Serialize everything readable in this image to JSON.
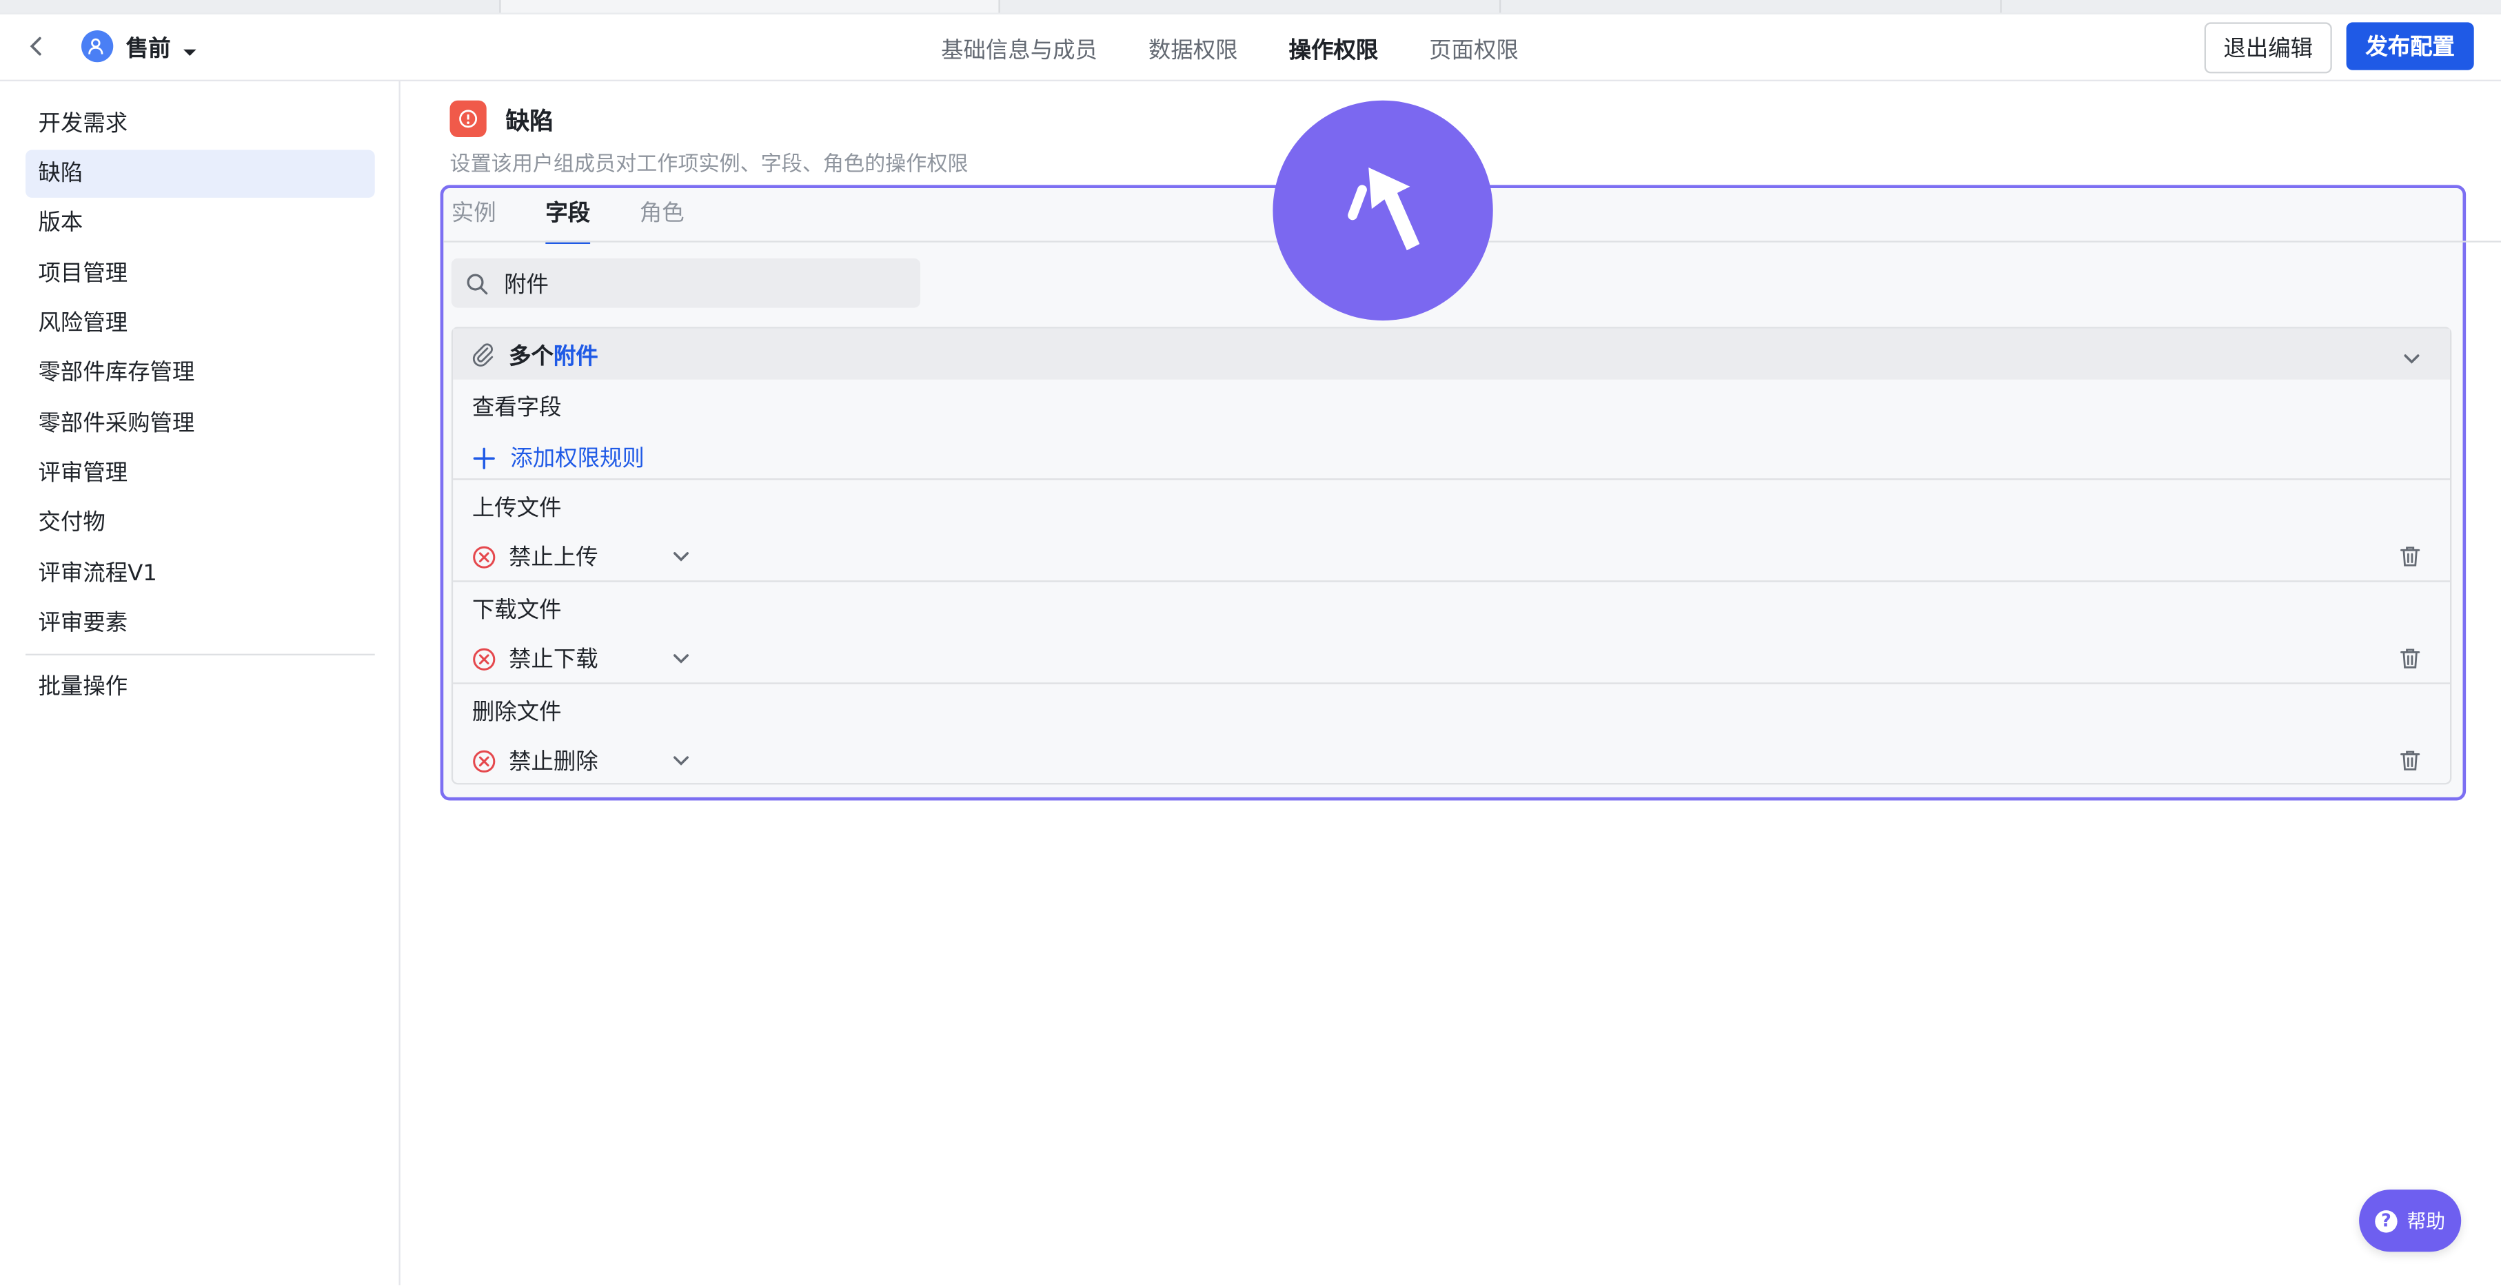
{
  "header": {
    "group_name": "售前",
    "tabs": [
      "基础信息与成员",
      "数据权限",
      "操作权限",
      "页面权限"
    ],
    "active_tab": "操作权限",
    "exit_label": "退出编辑",
    "publish_label": "发布配置"
  },
  "sidebar": {
    "items": [
      "开发需求",
      "缺陷",
      "版本",
      "项目管理",
      "风险管理",
      "零部件库存管理",
      "零部件采购管理",
      "评审管理",
      "交付物",
      "评审流程V1",
      "评审要素"
    ],
    "active": "缺陷",
    "batch_label": "批量操作"
  },
  "main": {
    "title": "缺陷",
    "description": "设置该用户组成员对工作项实例、字段、角色的操作权限",
    "subtabs": [
      "实例",
      "字段",
      "角色"
    ],
    "active_subtab": "字段",
    "search_value": "附件",
    "field": {
      "prefix": "多个",
      "highlight": "附件",
      "view_label": "查看字段",
      "add_rule_label": "添加权限规则",
      "rules": [
        {
          "label": "上传文件",
          "value": "禁止上传"
        },
        {
          "label": "下载文件",
          "value": "禁止下载"
        },
        {
          "label": "删除文件",
          "value": "禁止删除"
        }
      ]
    }
  },
  "help_label": "帮助",
  "colors": {
    "accent": "#1f5ae6",
    "cursor": "#7b68f0",
    "panel_border": "#7c6ff2",
    "danger": "#e5484d"
  },
  "icons": [
    "back-arrow-icon",
    "user-group-icon",
    "caret-down-icon",
    "bug-icon",
    "search-icon",
    "paperclip-icon",
    "chevron-down-icon",
    "plus-icon",
    "deny-circle-icon",
    "trash-icon",
    "cursor-icon",
    "help-icon"
  ]
}
